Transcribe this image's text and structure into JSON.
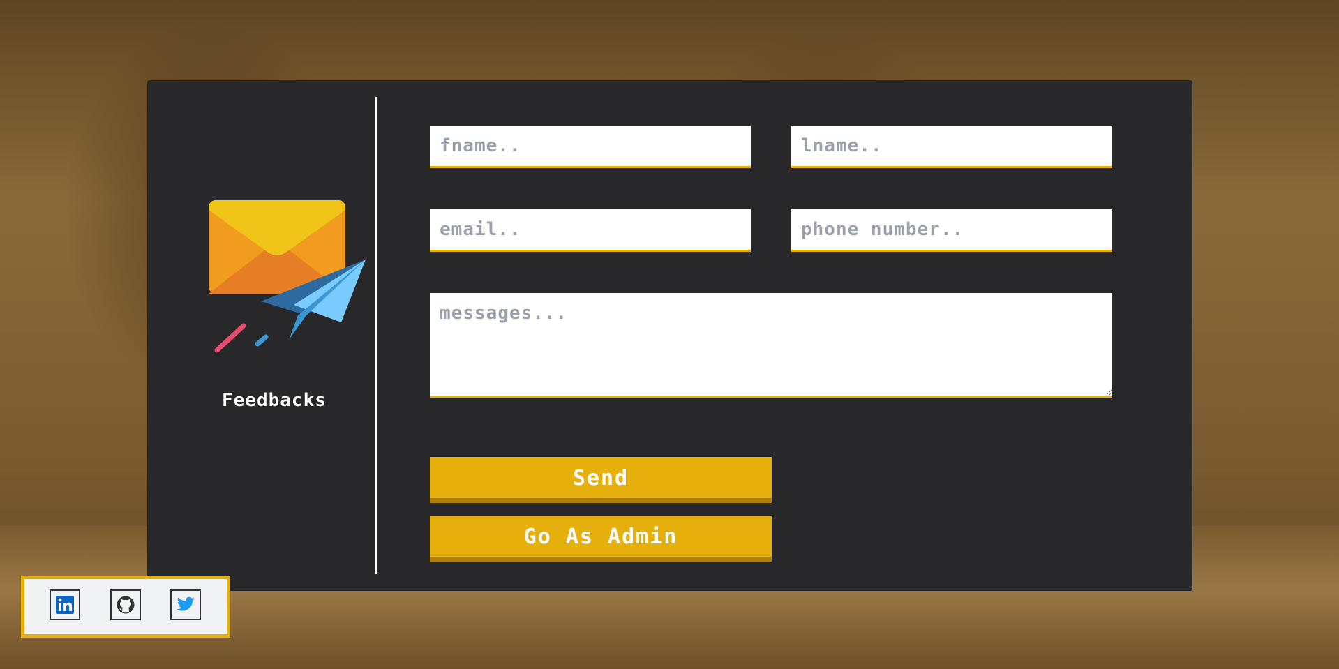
{
  "brand": {
    "label": "Feedbacks",
    "icon": "envelope-paper-plane-icon"
  },
  "form": {
    "fname_placeholder": "fname..",
    "lname_placeholder": "lname..",
    "email_placeholder": "email..",
    "phone_placeholder": "phone number..",
    "message_placeholder": "messages...",
    "send_label": "Send",
    "admin_label": "Go As Admin"
  },
  "social": {
    "items": [
      {
        "icon": "linkedin-icon"
      },
      {
        "icon": "github-icon"
      },
      {
        "icon": "twitter-icon"
      }
    ]
  },
  "colors": {
    "accent": "#e6b00c",
    "card": "#28282a",
    "linkedin": "#0a66c2",
    "twitter": "#1d9bf0"
  }
}
